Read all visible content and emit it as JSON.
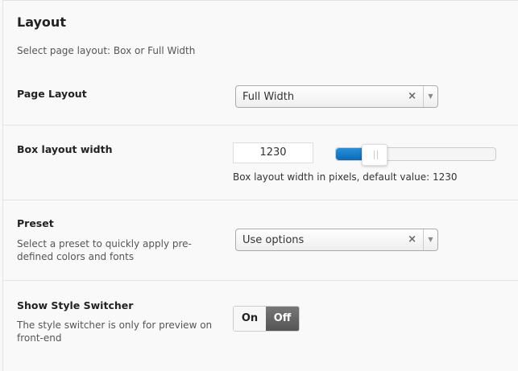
{
  "section": {
    "title": "Layout",
    "description": "Select page layout: Box or Full Width"
  },
  "page_layout": {
    "label": "Page Layout",
    "value": "Full Width",
    "clear_icon": "×",
    "arrow_icon": "▼"
  },
  "box_width": {
    "label": "Box layout width",
    "value": "1230",
    "slider_fraction": 0.24,
    "hint": "Box layout width in pixels, default value: 1230",
    "accent": "#0a74c4"
  },
  "preset": {
    "label": "Preset",
    "description": "Select a preset to quickly apply pre-defined colors and fonts",
    "value": "Use options",
    "clear_icon": "×",
    "arrow_icon": "▼"
  },
  "style_switcher": {
    "label": "Show Style Switcher",
    "description": "The style switcher is only for preview on front-end",
    "on_label": "On",
    "off_label": "Off",
    "selected": "Off"
  }
}
